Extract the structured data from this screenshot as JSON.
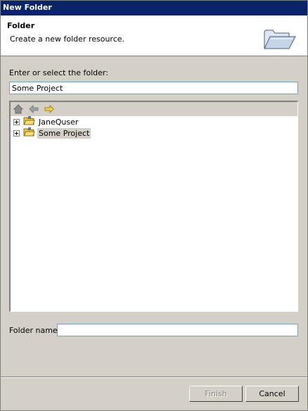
{
  "window": {
    "title": "New Folder"
  },
  "banner": {
    "title": "Folder",
    "description": "Create a new folder resource.",
    "icon": "folder-open-icon"
  },
  "parent": {
    "label": "Enter or select the folder:",
    "value": "Some Project"
  },
  "toolbar": {
    "home_icon": "home-icon",
    "back_icon": "back-arrow-icon",
    "forward_icon": "forward-arrow-icon"
  },
  "tree": {
    "items": [
      {
        "label": "JaneQuser",
        "selected": false
      },
      {
        "label": "Some Project",
        "selected": true
      }
    ]
  },
  "folder_name": {
    "label": "Folder name:",
    "value": ""
  },
  "buttons": {
    "finish": "Finish",
    "cancel": "Cancel"
  }
}
